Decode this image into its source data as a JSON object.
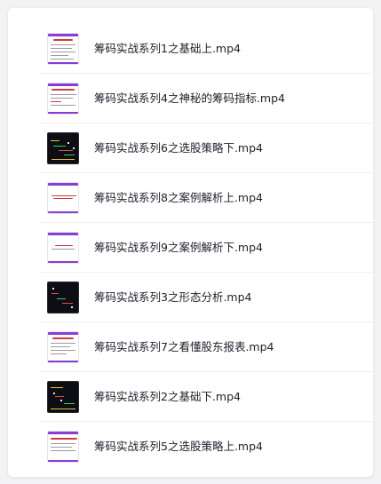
{
  "files": [
    {
      "name": "筹码实战系列1之基础上.mp4",
      "thumbnail": "slide-light-thumbnail"
    },
    {
      "name": "筹码实战系列4之神秘的筹码指标.mp4",
      "thumbnail": "slide-light-thumbnail"
    },
    {
      "name": "筹码实战系列6之选股策略下.mp4",
      "thumbnail": "chart-dark-thumbnail"
    },
    {
      "name": "筹码实战系列8之案例解析上.mp4",
      "thumbnail": "slide-light-thumbnail"
    },
    {
      "name": "筹码实战系列9之案例解析下.mp4",
      "thumbnail": "slide-light-thumbnail"
    },
    {
      "name": "筹码实战系列3之形态分析.mp4",
      "thumbnail": "chart-dark-thumbnail"
    },
    {
      "name": "筹码实战系列7之看懂股东报表.mp4",
      "thumbnail": "slide-light-thumbnail"
    },
    {
      "name": "筹码实战系列2之基础下.mp4",
      "thumbnail": "chart-dark-thumbnail"
    },
    {
      "name": "筹码实战系列5之选股策略上.mp4",
      "thumbnail": "slide-light-thumbnail"
    }
  ],
  "colors": {
    "accent": "#8a3cd6",
    "text": "#1f1f2b",
    "divider": "#f0f0f3"
  }
}
